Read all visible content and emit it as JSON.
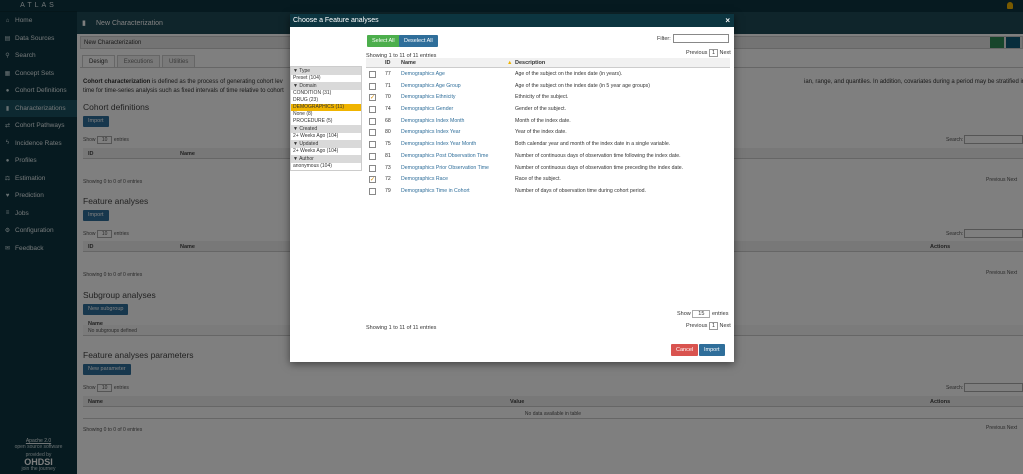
{
  "sidebar": {
    "brand": "ATLAS",
    "items": [
      {
        "label": "Home",
        "icon": "home-icon",
        "glyph": "⌂"
      },
      {
        "label": "Data Sources",
        "icon": "database-icon",
        "glyph": "▤"
      },
      {
        "label": "Search",
        "icon": "search-icon",
        "glyph": "⚲"
      },
      {
        "label": "Concept Sets",
        "icon": "shopping-cart-icon",
        "glyph": "▦"
      },
      {
        "label": "Cohort Definitions",
        "icon": "users-icon",
        "glyph": "●"
      },
      {
        "label": "Characterizations",
        "icon": "chart-icon",
        "glyph": "▮",
        "active": true
      },
      {
        "label": "Cohort Pathways",
        "icon": "sitemap-icon",
        "glyph": "⇄"
      },
      {
        "label": "Incidence Rates",
        "icon": "bolt-icon",
        "glyph": "ϟ"
      },
      {
        "label": "Profiles",
        "icon": "user-icon",
        "glyph": "●"
      },
      {
        "label": "Estimation",
        "icon": "balance-icon",
        "glyph": "⚖"
      },
      {
        "label": "Prediction",
        "icon": "heartbeat-icon",
        "glyph": "♥"
      },
      {
        "label": "Jobs",
        "icon": "tasks-icon",
        "glyph": "≡"
      },
      {
        "label": "Configuration",
        "icon": "cogs-icon",
        "glyph": "⚙"
      },
      {
        "label": "Feedback",
        "icon": "comment-icon",
        "glyph": "✉"
      }
    ],
    "footer": {
      "license": "Apache 2.0",
      "license_sub": "open source software",
      "provided": "provided by",
      "org": "OHDSI",
      "join": "join the journey"
    }
  },
  "header": {
    "title": "New Characterization"
  },
  "namebar": {
    "value": "New Characterization"
  },
  "tabs": [
    "Design",
    "Executions",
    "Utilities"
  ],
  "main": {
    "description": {
      "bold": "Cohort characterization",
      "text1": " is defined as the process of generating cohort lev",
      "text2": "time for time-series analysis such as fixed intervals of time relative to cohort",
      "right": "ian, range, and quantiles. In addition, covariates during a period may be stratified into temporal units of"
    },
    "cohort_defs": {
      "title": "Cohort definitions",
      "button": "Import",
      "show": "Show",
      "entries_val": "10",
      "entries": "entries",
      "search": "Search:",
      "col_id": "ID",
      "col_name": "Name",
      "info": "Showing 0 to 0 of 0 entries",
      "pager": "Previous Next"
    },
    "feature_analyses": {
      "title": "Feature analyses",
      "button": "Import",
      "show": "Show",
      "entries_val": "10",
      "entries": "entries",
      "search": "Search:",
      "col_id": "ID",
      "col_name": "Name",
      "col_actions": "Actions",
      "info": "Showing 0 to 0 of 0 entries",
      "pager": "Previous Next"
    },
    "subgroup": {
      "title": "Subgroup analyses",
      "button": "New subgroup",
      "col_name": "Name",
      "empty": "No subgroups defined"
    },
    "params": {
      "title": "Feature analyses parameters",
      "button": "New parameter",
      "show": "Show",
      "entries_val": "10",
      "entries": "entries",
      "search": "Search:",
      "col_name": "Name",
      "col_value": "Value",
      "col_actions": "Actions",
      "empty": "No data available in table",
      "info": "Showing 0 to 0 of 0 entries",
      "pager": "Previous Next"
    }
  },
  "modal": {
    "title": "Choose a Feature analyses",
    "close": "×",
    "select_all": "Select All",
    "deselect_all": "Deselect All",
    "filter_label": "Filter:",
    "showing_top": "Showing 1 to 11 of 11 entries",
    "showing_bottom": "Showing 1 to 11 of 11 entries",
    "previous": "Previous",
    "next": "Next",
    "page": "1",
    "show": "Show",
    "show_val": "15",
    "entries": "entries",
    "cancel": "Cancel",
    "import": "Import",
    "facets": [
      {
        "header": "Type",
        "items": [
          {
            "label": "Preset (104)"
          }
        ]
      },
      {
        "header": "Domain",
        "items": [
          {
            "label": "CONDITION (31)"
          },
          {
            "label": "DRUG (23)"
          },
          {
            "label": "DEMOGRAPHICS (11)",
            "selected": true
          },
          {
            "label": "None (8)"
          },
          {
            "label": "PROCEDURE (5)"
          }
        ]
      },
      {
        "header": "Created",
        "items": [
          {
            "label": "2+ Weeks Ago (104)"
          }
        ]
      },
      {
        "header": "Updated",
        "items": [
          {
            "label": "2+ Weeks Ago (104)"
          }
        ]
      },
      {
        "header": "Author",
        "items": [
          {
            "label": "anonymous (104)"
          }
        ]
      }
    ],
    "columns": {
      "id": "ID",
      "name": "Name",
      "description": "Description"
    },
    "rows": [
      {
        "id": "77",
        "name": "Demographics Age",
        "description": "Age of the subject on the index date (in years).",
        "checked": false
      },
      {
        "id": "71",
        "name": "Demographics Age Group",
        "description": "Age of the subject on the index date (in 5 year age groups)",
        "checked": false
      },
      {
        "id": "70",
        "name": "Demographics Ethnicity",
        "description": "Ethnicity of the subject.",
        "checked": true
      },
      {
        "id": "74",
        "name": "Demographics Gender",
        "description": "Gender of the subject.",
        "checked": false
      },
      {
        "id": "68",
        "name": "Demographics Index Month",
        "description": "Month of the index date.",
        "checked": false
      },
      {
        "id": "80",
        "name": "Demographics Index Year",
        "description": "Year of the index date.",
        "checked": false
      },
      {
        "id": "75",
        "name": "Demographics Index Year Month",
        "description": "Both calendar year and month of the index date in a single variable.",
        "checked": false
      },
      {
        "id": "81",
        "name": "Demographics Post Observation Time",
        "description": "Number of continuous days of observation time following the index date.",
        "checked": false
      },
      {
        "id": "73",
        "name": "Demographics Prior Observation Time",
        "description": "Number of continuous days of observation time preceding the index date.",
        "checked": false
      },
      {
        "id": "72",
        "name": "Demographics Race",
        "description": "Race of the subject.",
        "checked": true
      },
      {
        "id": "79",
        "name": "Demographics Time in Cohort",
        "description": "Number of days of observation time during cohort period.",
        "checked": false
      }
    ]
  }
}
